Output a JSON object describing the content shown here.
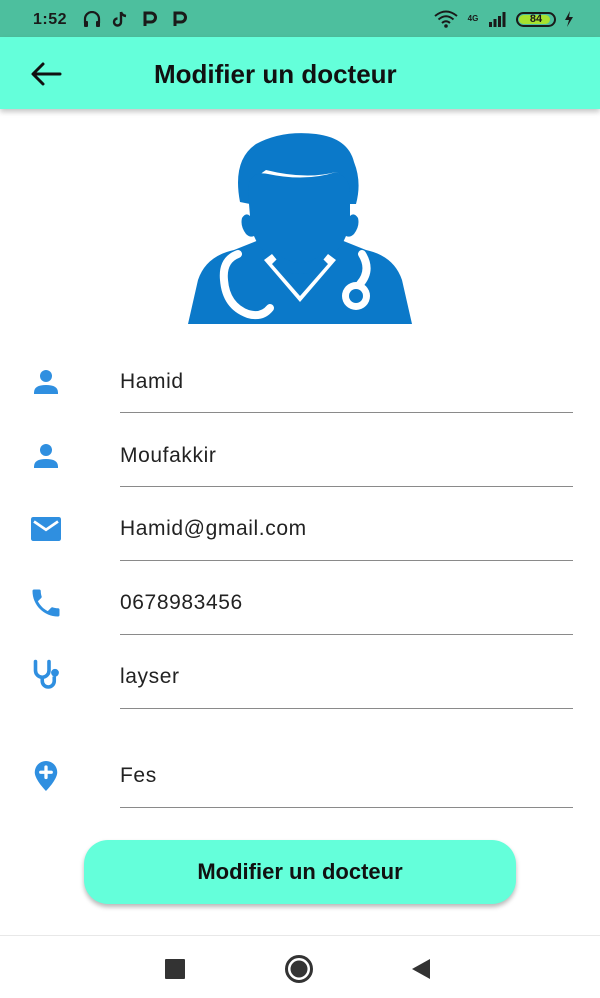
{
  "status_bar": {
    "time": "1:52",
    "network": "4G",
    "battery": "84",
    "icons": [
      "headphones-icon",
      "tiktok-icon",
      "p-app-icon",
      "p-app-icon",
      "wifi-icon",
      "signal-icon",
      "battery-icon",
      "charging-icon"
    ]
  },
  "app_bar": {
    "title": "Modifier un docteur",
    "back_icon": "arrow-back-icon"
  },
  "form": {
    "first_name": {
      "value": "Hamid",
      "icon": "person-icon"
    },
    "last_name": {
      "value": "Moufakkir",
      "icon": "person-icon"
    },
    "email": {
      "value": "Hamid@gmail.com",
      "icon": "email-icon"
    },
    "phone": {
      "value": "0678983456",
      "icon": "phone-icon"
    },
    "specialty": {
      "value": "layser",
      "icon": "stethoscope-icon"
    },
    "city": {
      "value": "Fes",
      "icon": "location-add-icon"
    }
  },
  "submit_button": {
    "label": "Modifier un docteur"
  },
  "colors": {
    "status_bar": "#4dbf9e",
    "accent": "#64ffda",
    "icon_blue": "#2f8fe0",
    "avatar_blue": "#0b79c9"
  },
  "nav": {
    "icons": [
      "recents-square-icon",
      "home-circle-icon",
      "back-triangle-icon"
    ]
  }
}
